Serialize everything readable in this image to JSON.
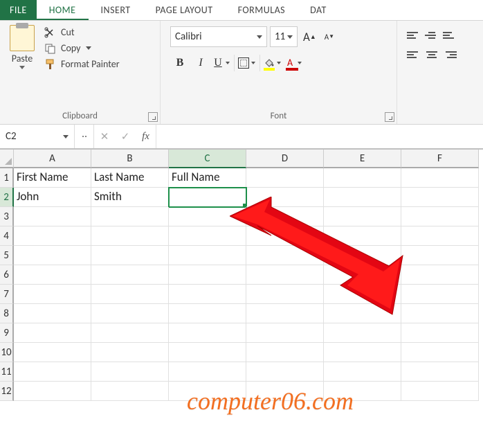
{
  "tabs": {
    "file": "FILE",
    "home": "HOME",
    "insert": "INSERT",
    "page_layout": "PAGE LAYOUT",
    "formulas": "FORMULAS",
    "data": "DAT"
  },
  "ribbon": {
    "clipboard": {
      "paste": "Paste",
      "cut": "Cut",
      "copy": "Copy",
      "format_painter": "Format Painter",
      "label": "Clipboard"
    },
    "font": {
      "name": "Calibri",
      "size": "11",
      "bold": "B",
      "italic": "I",
      "underline": "U",
      "grow": "A",
      "shrink": "A",
      "fontcolor_letter": "A",
      "label": "Font"
    }
  },
  "formula_bar": {
    "name_box": "C2",
    "cancel": "✕",
    "enter": "✓",
    "fx": "fx",
    "value": ""
  },
  "grid": {
    "columns": [
      "A",
      "B",
      "C",
      "D",
      "E",
      "F"
    ],
    "rows": [
      "1",
      "2",
      "3",
      "4",
      "5",
      "6",
      "7",
      "8",
      "9",
      "10",
      "11",
      "12"
    ],
    "selected_col": "C",
    "selected_row": "2",
    "data": {
      "A1": "First Name",
      "B1": "Last Name",
      "C1": "Full Name",
      "A2": "John",
      "B2": "Smith"
    }
  },
  "chart_data": {
    "type": "table",
    "columns": [
      "First Name",
      "Last Name",
      "Full Name"
    ],
    "rows": [
      [
        "John",
        "Smith",
        ""
      ]
    ]
  },
  "watermark": "computer06.com"
}
